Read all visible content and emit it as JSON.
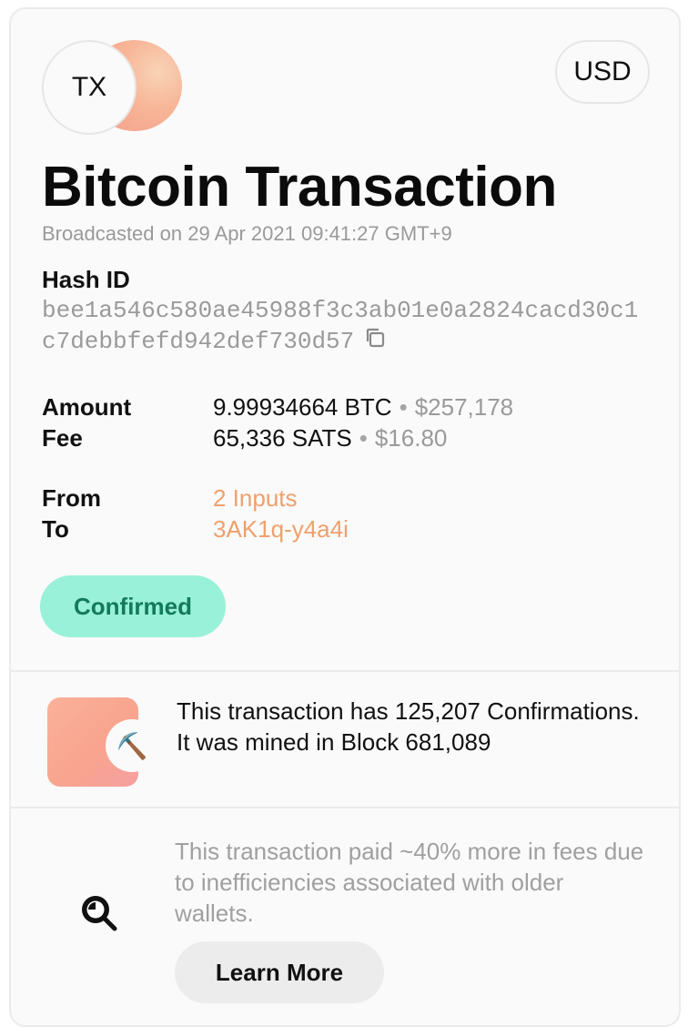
{
  "header": {
    "badge_text": "TX",
    "currency": "USD",
    "title": "Bitcoin Transaction",
    "broadcast_text": "Broadcasted on 29 Apr 2021 09:41:27 GMT+9"
  },
  "hash": {
    "label": "Hash ID",
    "value": "bee1a546c580ae45988f3c3ab01e0a2824cacd30c1c7debbfefd942def730d57"
  },
  "amount": {
    "label": "Amount",
    "value": "9.99934664 BTC",
    "separator": "•",
    "fiat": "$257,178"
  },
  "fee": {
    "label": "Fee",
    "value": "65,336 SATS",
    "separator": "•",
    "fiat": "$16.80"
  },
  "from": {
    "label": "From",
    "value": "2 Inputs"
  },
  "to": {
    "label": "To",
    "value": "3AK1q-y4a4i"
  },
  "status": {
    "label": "Confirmed",
    "color": "#98f1d8",
    "text_color": "#137a5a"
  },
  "mined": {
    "icon": "pickaxe-icon",
    "glyph": "⛏️",
    "text": "This transaction has 125,207 Confirmations. It was mined in Block 681,089"
  },
  "fee_notice": {
    "icon": "magnifier-icon",
    "text": "This transaction paid ~40% more in fees due to inefficiencies associated with older wallets.",
    "button_label": "Learn More"
  },
  "colors": {
    "accent_link": "#f0a06c",
    "muted_text": "#9a9a9a"
  }
}
